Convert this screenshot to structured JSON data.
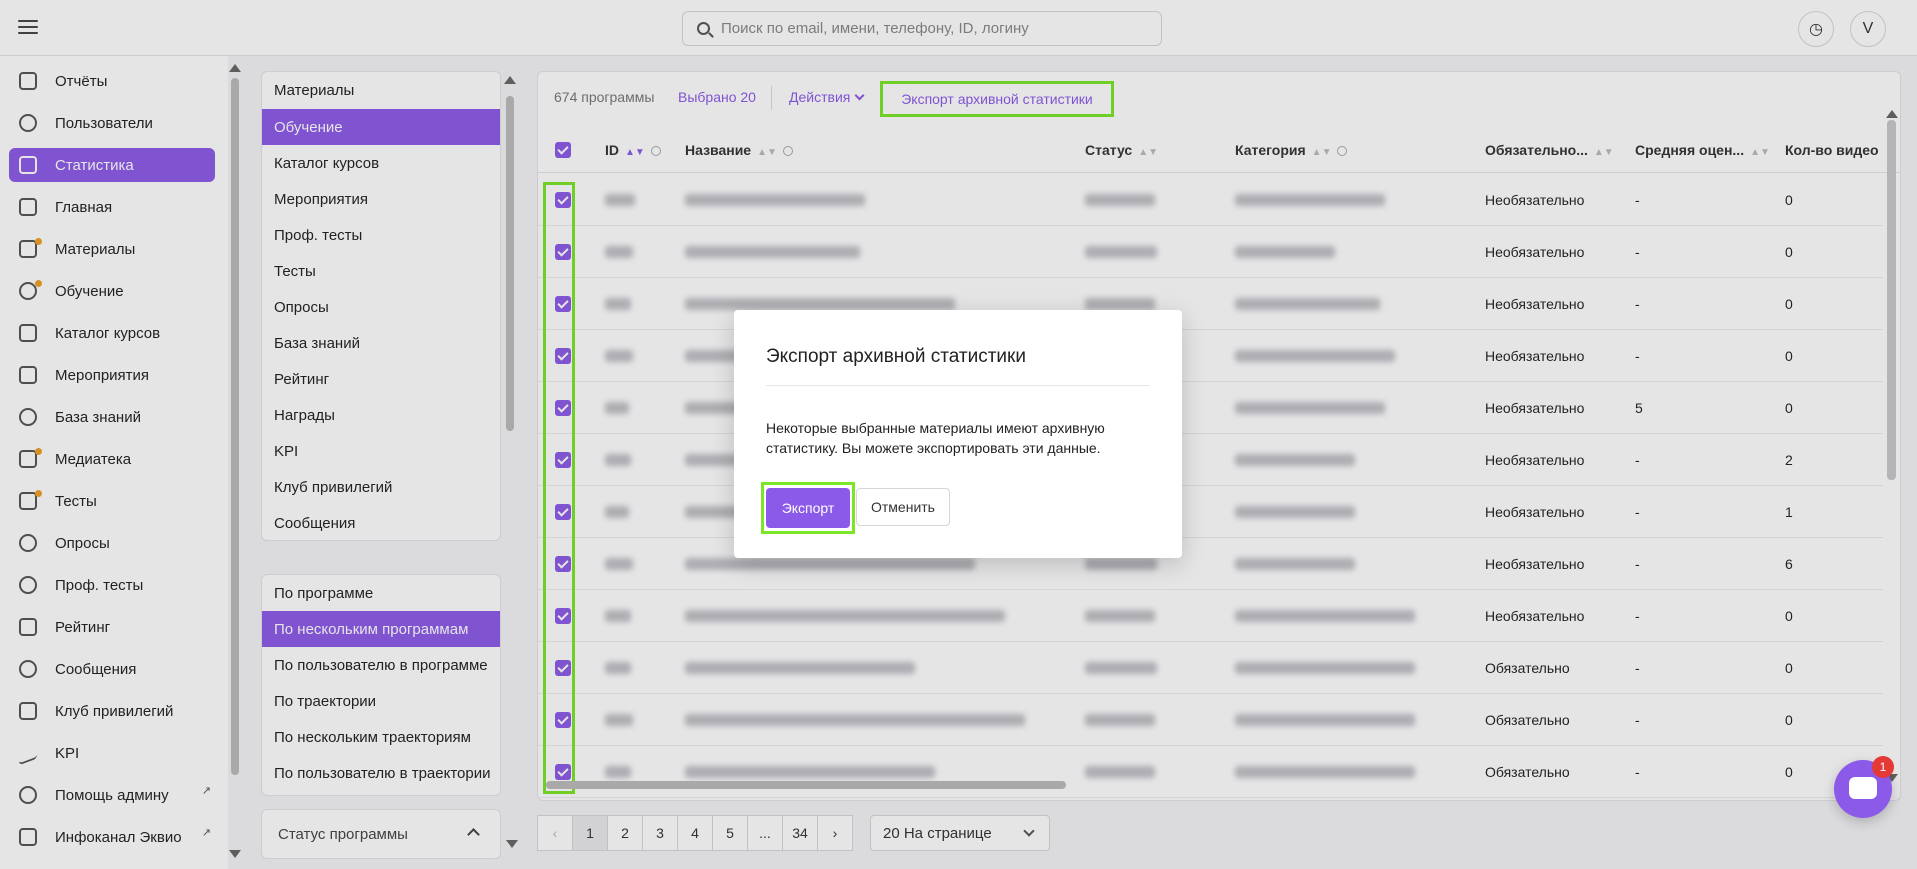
{
  "header": {
    "search_placeholder": "Поиск по email, имени, телефону, ID, логину",
    "avatar_letter": "V"
  },
  "sidebar": {
    "items": [
      {
        "label": "Отчёты",
        "icon": "report-icon"
      },
      {
        "label": "Пользователи",
        "icon": "user-icon"
      },
      {
        "label": "Статистика",
        "icon": "chart-icon",
        "active": true
      },
      {
        "label": "Главная",
        "icon": "home-icon"
      },
      {
        "label": "Материалы",
        "icon": "materials-icon"
      },
      {
        "label": "Обучение",
        "icon": "learning-icon"
      },
      {
        "label": "Каталог курсов",
        "icon": "graduation-cap-icon"
      },
      {
        "label": "Мероприятия",
        "icon": "calendar-icon"
      },
      {
        "label": "База знаний",
        "icon": "info-icon"
      },
      {
        "label": "Медиатека",
        "icon": "media-icon"
      },
      {
        "label": "Тесты",
        "icon": "test-icon"
      },
      {
        "label": "Опросы",
        "icon": "question-icon"
      },
      {
        "label": "Проф. тесты",
        "icon": "prof-test-icon"
      },
      {
        "label": "Рейтинг",
        "icon": "trophy-icon"
      },
      {
        "label": "Сообщения",
        "icon": "message-icon"
      },
      {
        "label": "Клуб привилегий",
        "icon": "gift-icon"
      },
      {
        "label": "KPI",
        "icon": "trend-icon"
      },
      {
        "label": "Помощь админу",
        "icon": "star-icon",
        "external": true
      },
      {
        "label": "Инфоканал Эквио",
        "icon": "send-icon",
        "external": true
      }
    ]
  },
  "sections": {
    "items": [
      "Материалы",
      "Обучение",
      "Каталог курсов",
      "Мероприятия",
      "Проф. тесты",
      "Тесты",
      "Опросы",
      "База знаний",
      "Рейтинг",
      "Награды",
      "KPI",
      "Клуб привилегий",
      "Сообщения"
    ],
    "active": "Обучение"
  },
  "reports": {
    "items": [
      "По программе",
      "По нескольким программам",
      "По пользователю в программе",
      "По траектории",
      "По нескольким траекториям",
      "По пользователю в траектории"
    ],
    "active": "По нескольким программам"
  },
  "status_filter": "Статус программы",
  "toolbar": {
    "count": "674 программы",
    "selected": "Выбрано 20",
    "actions": "Действия",
    "export_archive": "Экспорт архивной статистики"
  },
  "table": {
    "columns": [
      "ID",
      "Название",
      "Статус",
      "Категория",
      "Обязательно...",
      "Средняя оцен...",
      "Кол-во видео"
    ],
    "rows": [
      {
        "required": "Необязательно",
        "avg": "-",
        "videos": "0"
      },
      {
        "required": "Необязательно",
        "avg": "-",
        "videos": "0"
      },
      {
        "required": "Необязательно",
        "avg": "-",
        "videos": "0"
      },
      {
        "required": "Необязательно",
        "avg": "-",
        "videos": "0"
      },
      {
        "required": "Необязательно",
        "avg": "5",
        "videos": "0"
      },
      {
        "required": "Необязательно",
        "avg": "-",
        "videos": "2"
      },
      {
        "required": "Необязательно",
        "avg": "-",
        "videos": "1"
      },
      {
        "required": "Необязательно",
        "avg": "-",
        "videos": "6"
      },
      {
        "required": "Необязательно",
        "avg": "-",
        "videos": "0"
      },
      {
        "required": "Обязательно",
        "avg": "-",
        "videos": "0"
      },
      {
        "required": "Обязательно",
        "avg": "-",
        "videos": "0"
      },
      {
        "required": "Обязательно",
        "avg": "-",
        "videos": "0"
      }
    ]
  },
  "pagination": {
    "prev": "‹",
    "pages": [
      "1",
      "2",
      "3",
      "4",
      "5",
      "...",
      "34"
    ],
    "next": "›",
    "active": "1",
    "per_page": "20 На странице"
  },
  "modal": {
    "title": "Экспорт архивной статистики",
    "text": "Некоторые выбранные материалы имеют архивную статистику. Вы можете экспортировать эти данные.",
    "export_label": "Экспорт",
    "cancel_label": "Отменить"
  },
  "chat": {
    "badge": "1"
  },
  "colors": {
    "accent": "#8c5ae8",
    "highlight": "#7ae626",
    "badge": "#e53935"
  }
}
